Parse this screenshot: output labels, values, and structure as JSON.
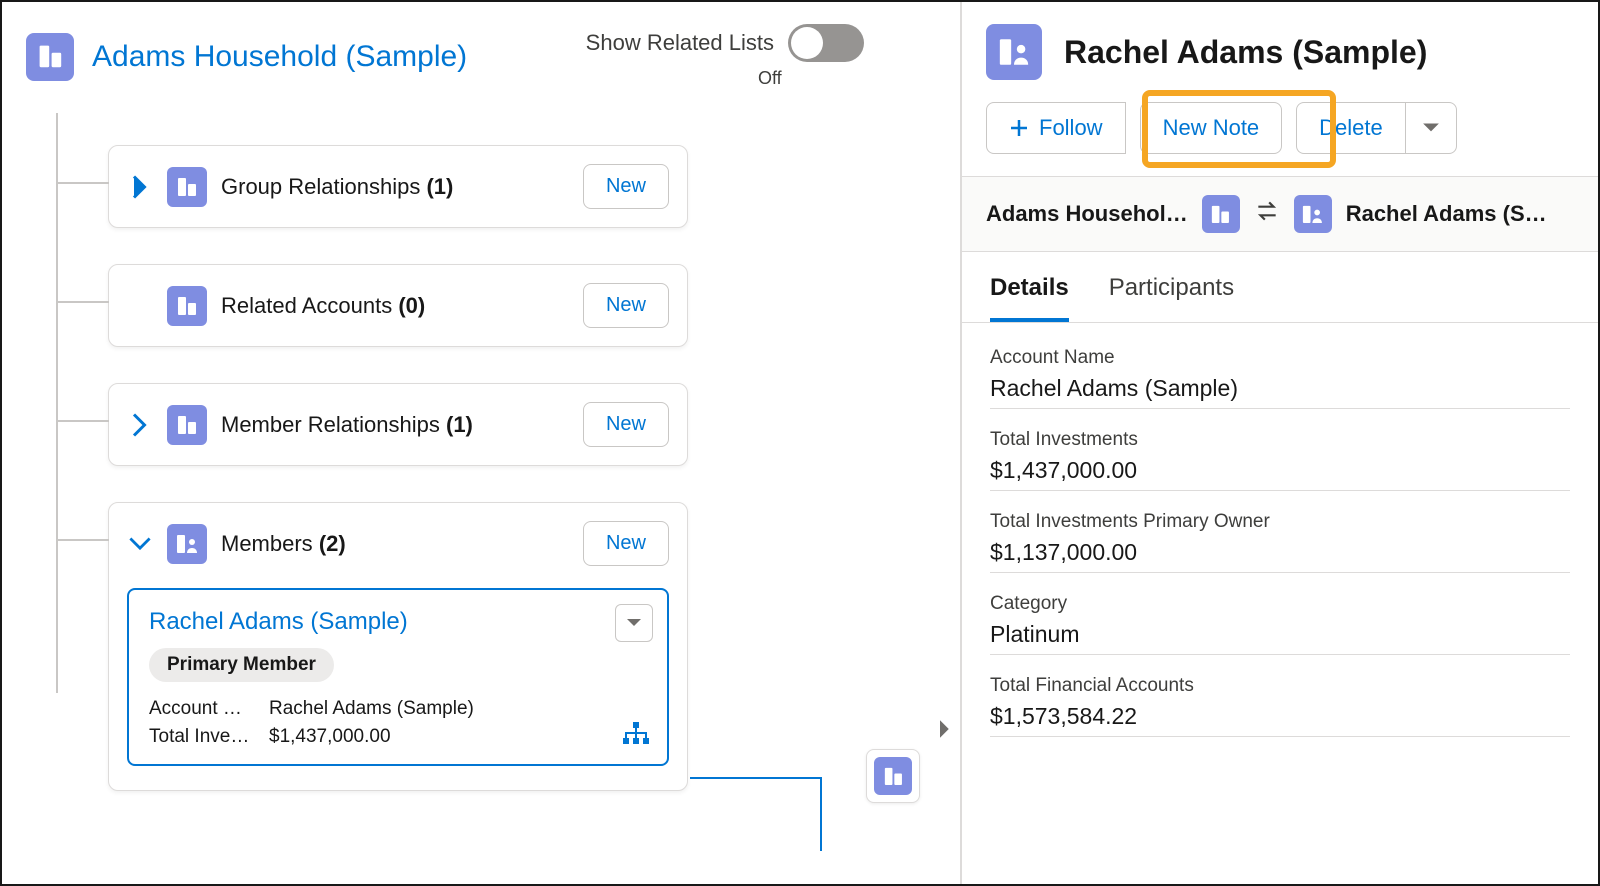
{
  "left": {
    "title": "Adams Household (Sample)",
    "toggle_label": "Show Related Lists",
    "toggle_state": "Off",
    "sections": [
      {
        "id": "group-rel",
        "chevron": "right",
        "icon": "account",
        "title": "Group Relationships",
        "count": "(1)",
        "button": "New",
        "expanded": false
      },
      {
        "id": "related-acc",
        "chevron": "none",
        "icon": "account",
        "title": "Related Accounts",
        "count": "(0)",
        "button": "New",
        "expanded": false
      },
      {
        "id": "member-rel",
        "chevron": "right",
        "icon": "account",
        "title": "Member Relationships",
        "count": "(1)",
        "button": "New",
        "expanded": false
      },
      {
        "id": "members",
        "chevron": "down",
        "icon": "householdperson",
        "title": "Members",
        "count": "(2)",
        "button": "New",
        "expanded": true
      }
    ],
    "member_card": {
      "name": "Rachel Adams (Sample)",
      "badge": "Primary Member",
      "rows": [
        {
          "label": "Account …",
          "value": "Rachel Adams (Sample)"
        },
        {
          "label": "Total Inve…",
          "value": "$1,437,000.00"
        }
      ]
    }
  },
  "right": {
    "title": "Rachel Adams (Sample)",
    "actions": {
      "follow": "Follow",
      "new_note": "New Note",
      "delete": "Delete"
    },
    "breadcrumb": {
      "left": "Adams Househol…",
      "right": "Rachel Adams (S…"
    },
    "tabs": [
      {
        "label": "Details",
        "active": true
      },
      {
        "label": "Participants",
        "active": false
      }
    ],
    "fields": [
      {
        "label": "Account Name",
        "value": "Rachel Adams (Sample)"
      },
      {
        "label": "Total Investments",
        "value": "$1,437,000.00"
      },
      {
        "label": "Total Investments Primary Owner",
        "value": "$1,137,000.00"
      },
      {
        "label": "Category",
        "value": "Platinum"
      },
      {
        "label": "Total Financial Accounts",
        "value": "$1,573,584.22"
      }
    ]
  },
  "glyphs": {
    "chevron_right": "›",
    "chevron_down": "⌄"
  }
}
